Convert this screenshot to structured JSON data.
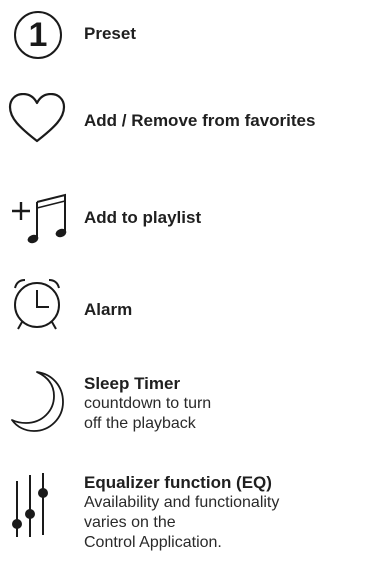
{
  "legend": {
    "items": [
      {
        "icon": "preset-number-icon",
        "badge": "1",
        "title": "Preset",
        "lines": []
      },
      {
        "icon": "heart-icon",
        "title": "Add / Remove from favorites",
        "lines": []
      },
      {
        "icon": "add-to-playlist-icon",
        "title": "Add to playlist",
        "lines": []
      },
      {
        "icon": "alarm-clock-icon",
        "title": "Alarm",
        "lines": []
      },
      {
        "icon": "crescent-moon-icon",
        "title": "Sleep Timer",
        "lines": [
          "countdown to turn",
          "off the playback"
        ]
      },
      {
        "icon": "equalizer-sliders-icon",
        "title": "Equalizer function (EQ)",
        "lines": [
          "Availability and functionality",
          "varies on the",
          "Control Application."
        ]
      }
    ]
  },
  "colors": {
    "icon_stroke": "#1a1a1a",
    "text": "#222222"
  }
}
